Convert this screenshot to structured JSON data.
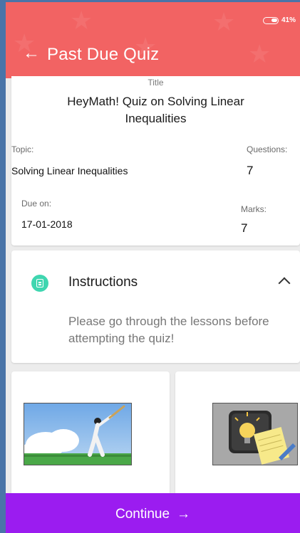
{
  "status_bar": {
    "battery_percent": "41%"
  },
  "header": {
    "title": "Past Due Quiz",
    "back_icon": "arrow-left-icon"
  },
  "quiz": {
    "title_label": "Title",
    "title": "HeyMath! Quiz on Solving Linear Inequalities",
    "topic_label": "Topic:",
    "topic": "Solving Linear Inequalities",
    "questions_label": "Questions:",
    "questions": "7",
    "due_label": "Due on:",
    "due": "17-01-2018",
    "marks_label": "Marks:",
    "marks": "7"
  },
  "instructions": {
    "title": "Instructions",
    "text": "Please go through the lessons before attempting the quiz!",
    "icon": "document-icon",
    "expanded": true
  },
  "lessons": [
    {
      "thumbnail": "cricket-batsman-image"
    },
    {
      "thumbnail": "lightbulb-notepad-image"
    }
  ],
  "footer": {
    "continue_label": "Continue",
    "continue_icon": "arrow-right-icon"
  },
  "colors": {
    "header": "#f26363",
    "instructions_icon": "#3fd6b0",
    "continue": "#9b1cf0"
  }
}
